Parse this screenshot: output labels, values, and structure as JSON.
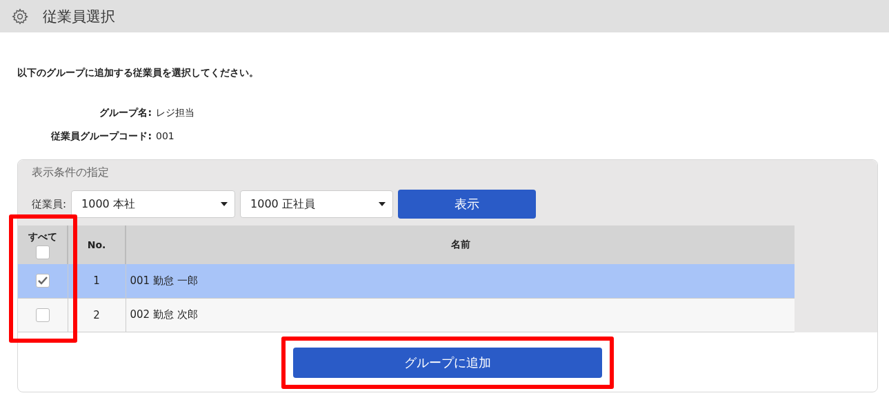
{
  "header": {
    "title": "従業員選択"
  },
  "instruction": "以下のグループに追加する従業員を選択してください。",
  "fields": [
    {
      "label": "グループ名:",
      "value": "レジ担当"
    },
    {
      "label": "従業員グループコード:",
      "value": "001"
    }
  ],
  "filter_panel": {
    "title": "表示条件の指定",
    "label": "従業員:",
    "selects": [
      {
        "value": "1000 本社"
      },
      {
        "value": "1000 正社員"
      }
    ],
    "show_button": "表示"
  },
  "table": {
    "highlighted": true,
    "select_all": {
      "label": "すべて",
      "checked": false
    },
    "columns": [
      "No.",
      "名前"
    ],
    "rows": [
      {
        "no": "1",
        "name": "001 勤怠 一郎",
        "checked": true,
        "selected": true
      },
      {
        "no": "2",
        "name": "002 勤怠 次郎",
        "checked": false,
        "selected": false
      }
    ]
  },
  "add_button": {
    "label": "グループに追加",
    "highlighted": true
  }
}
